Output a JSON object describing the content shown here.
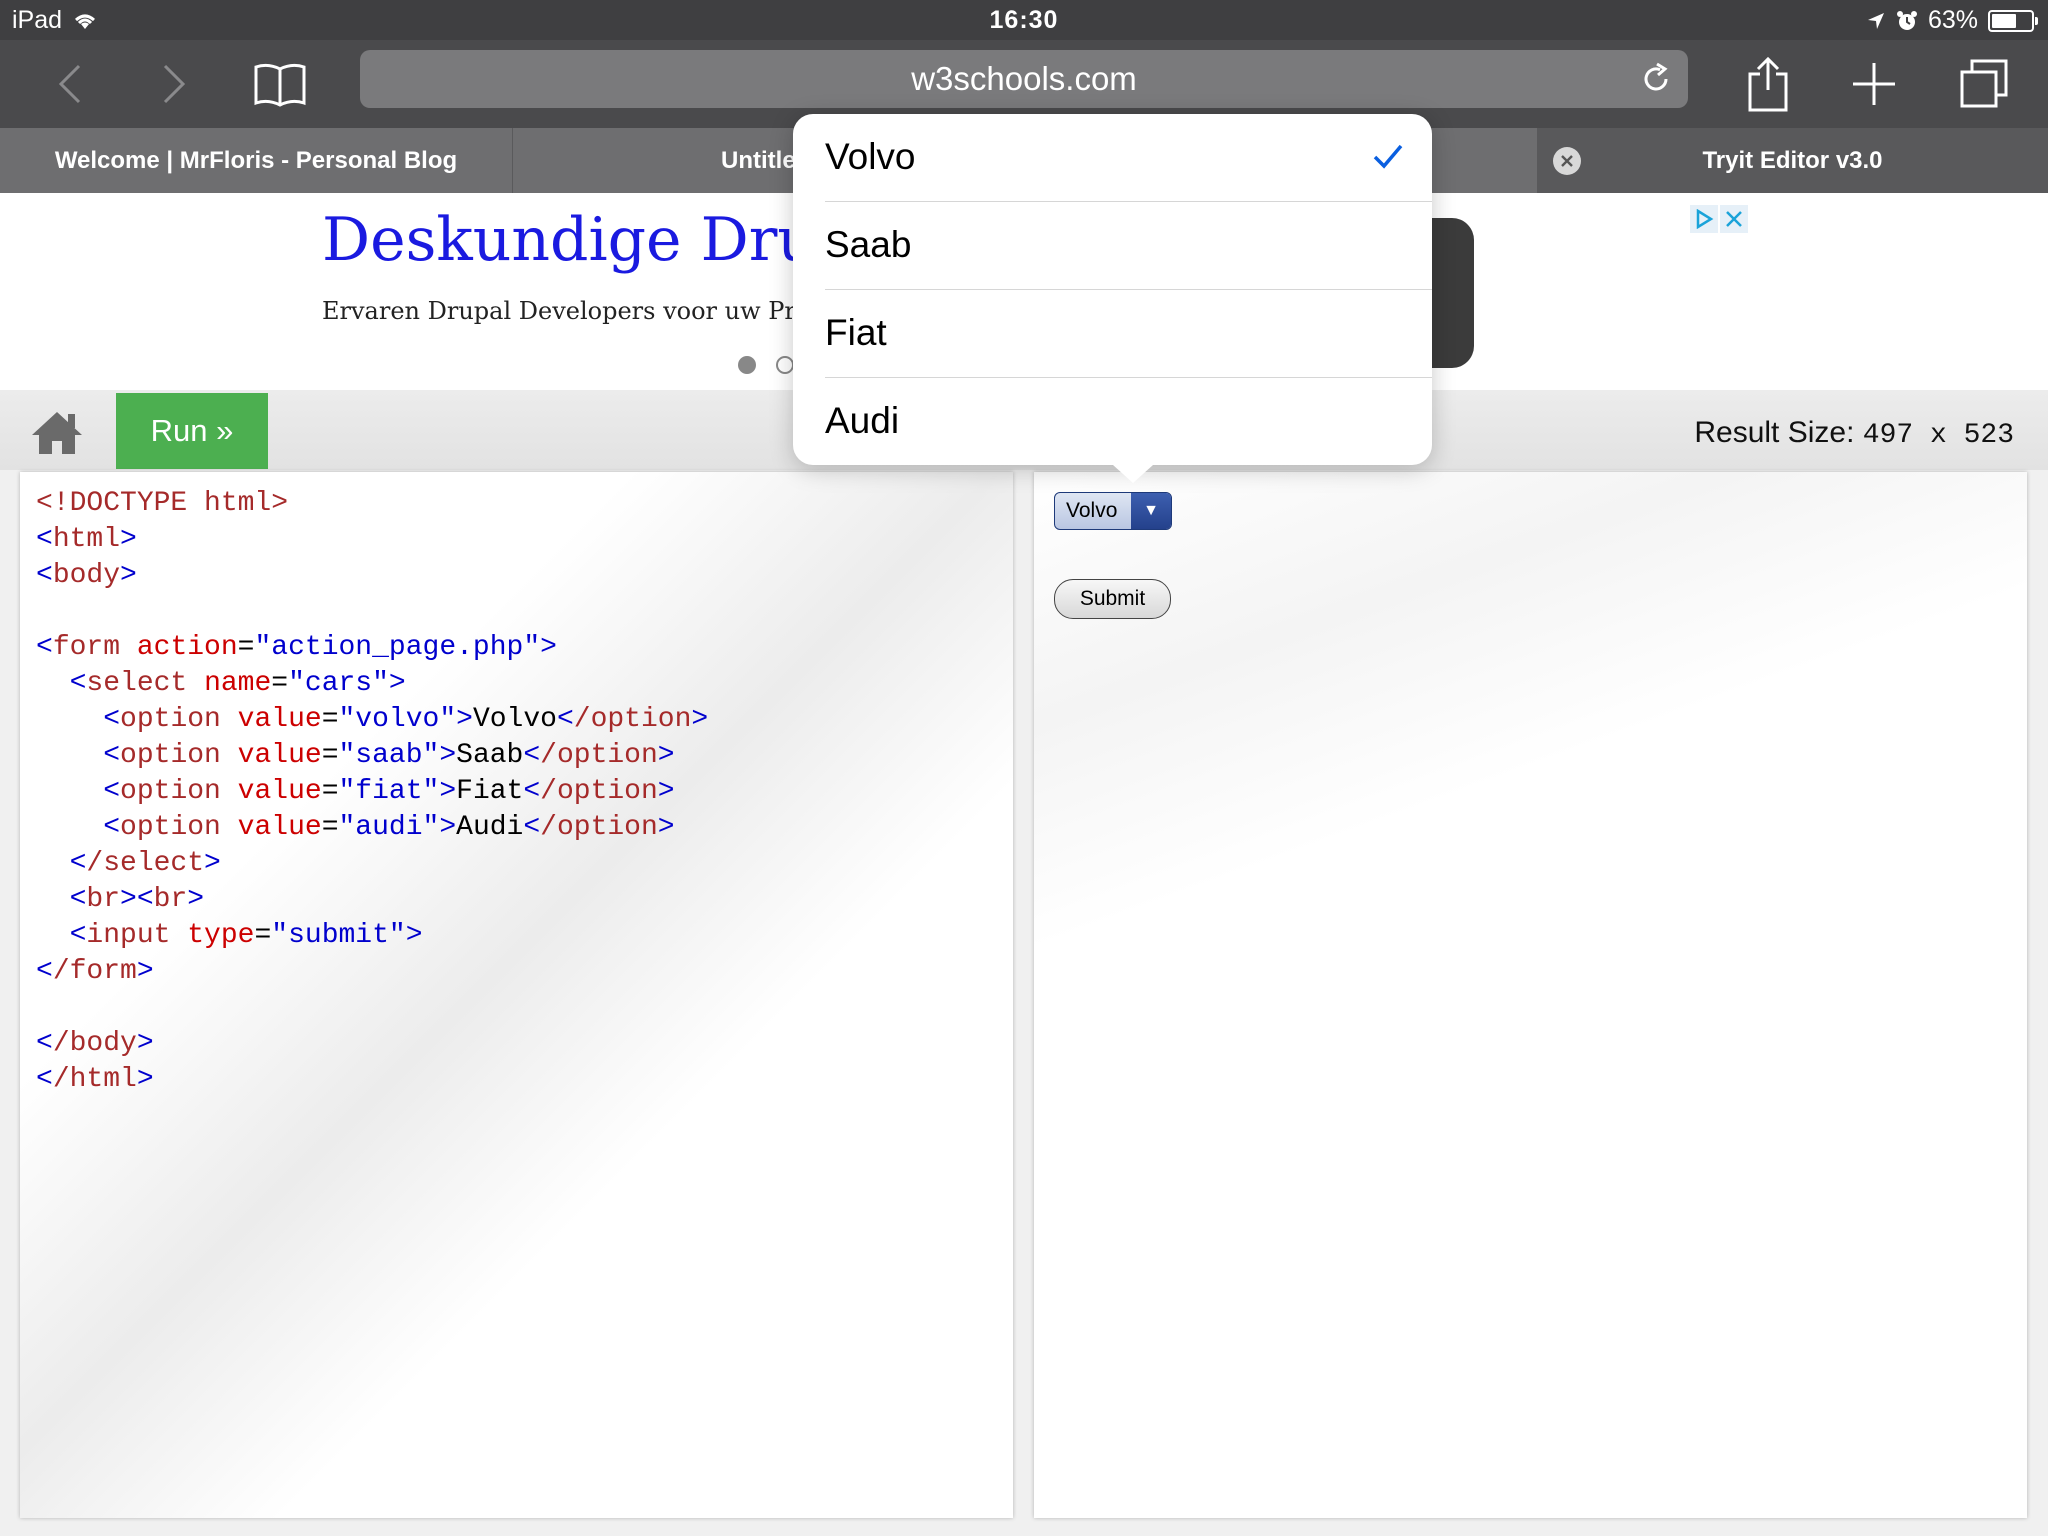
{
  "status_bar": {
    "device": "iPad",
    "time": "16:30",
    "battery": "63%",
    "battery_level": 0.63
  },
  "toolbar": {
    "url": "w3schools.com",
    "icons": [
      "back-icon",
      "forward-icon",
      "bookmarks-icon",
      "reload-icon",
      "share-icon",
      "new-tab-icon",
      "tabs-icon"
    ]
  },
  "tabs": [
    {
      "label": "Welcome | MrFloris - Personal Blog"
    },
    {
      "label": "Untitle"
    },
    {
      "label": "Tryit Editor v3.0"
    }
  ],
  "ad": {
    "title": "Deskundige Drup",
    "subtitle": "Ervaren Drupal Developers voor uw Proble"
  },
  "editor": {
    "run_label": "Run »",
    "result_size_label": "Result Size:",
    "result_size_value": "497 x 523"
  },
  "code_lines": [
    "<!DOCTYPE html>",
    "<html>",
    "<body>",
    "",
    "<form action=\"action_page.php\">",
    "  <select name=\"cars\">",
    "    <option value=\"volvo\">Volvo</option>",
    "    <option value=\"saab\">Saab</option>",
    "    <option value=\"fiat\">Fiat</option>",
    "    <option value=\"audi\">Audi</option>",
    "  </select>",
    "  <br><br>",
    "  <input type=\"submit\">",
    "</form>",
    "",
    "</body>",
    "</html>"
  ],
  "result": {
    "select_value": "Volvo",
    "submit_label": "Submit"
  },
  "dropdown": {
    "options": [
      "Volvo",
      "Saab",
      "Fiat",
      "Audi"
    ],
    "selected": "Volvo"
  },
  "colors": {
    "run_button": "#4caf50",
    "code_tag": "#a52a2a",
    "code_attr": "#cc0000",
    "code_value": "#0000cd",
    "check": "#0a5fe0",
    "ad_title": "#1a1ae0"
  }
}
